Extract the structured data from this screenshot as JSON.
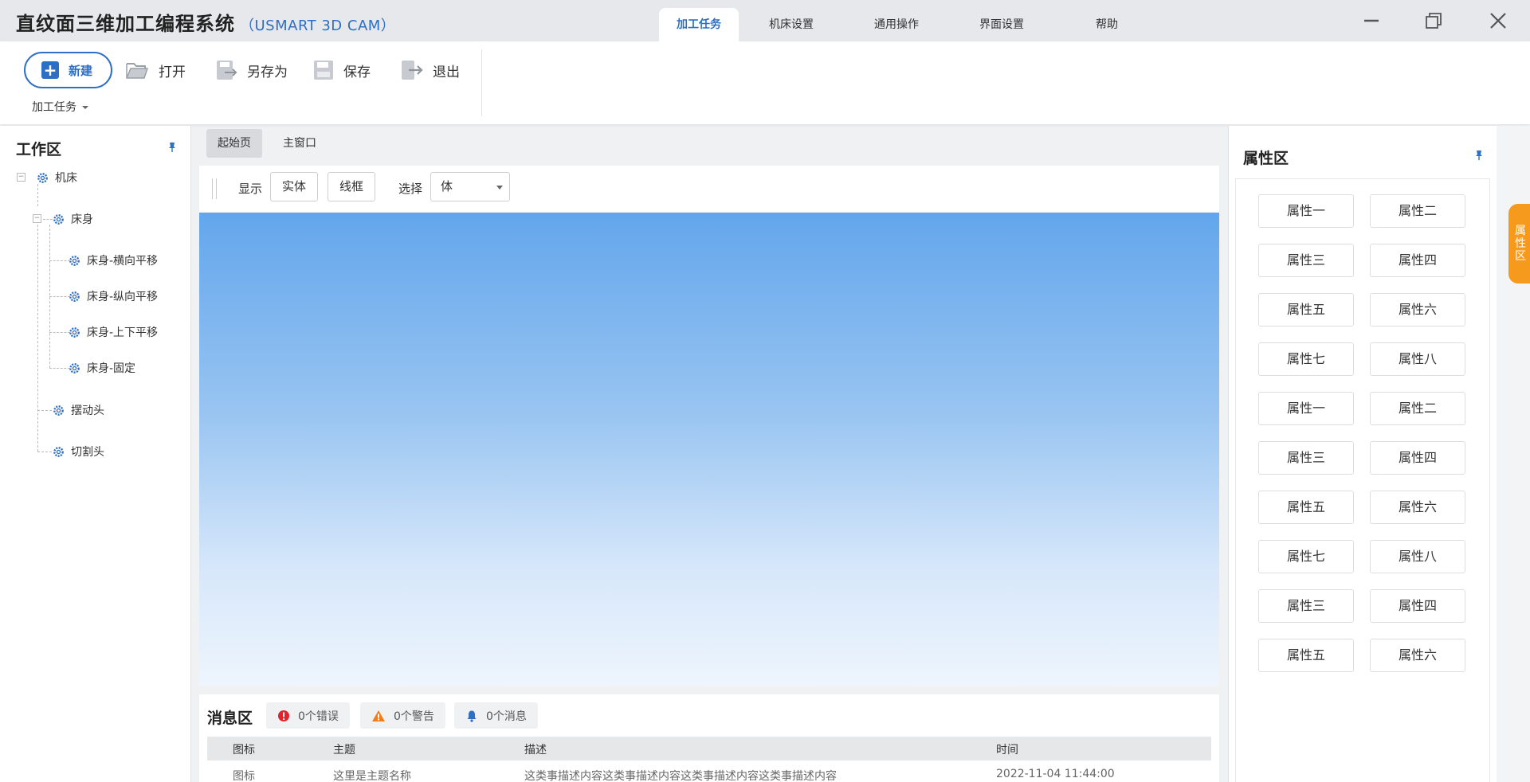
{
  "app": {
    "title": "直纹面三维加工编程系统",
    "subtitle": "（USMART 3D CAM）"
  },
  "menu_tabs": [
    {
      "label": "加工任务",
      "active": true
    },
    {
      "label": "机床设置",
      "active": false
    },
    {
      "label": "通用操作",
      "active": false
    },
    {
      "label": "界面设置",
      "active": false
    },
    {
      "label": "帮助",
      "active": false
    }
  ],
  "ribbon": {
    "new_label": "新建",
    "open_label": "打开",
    "saveas_label": "另存为",
    "save_label": "保存",
    "exit_label": "退出",
    "group_label": "加工任务"
  },
  "workspace": {
    "title": "工作区",
    "tree": {
      "root": "机床",
      "bed": "床身",
      "bed_children": [
        "床身-横向平移",
        "床身-纵向平移",
        "床身-上下平移",
        "床身-固定"
      ],
      "swing_head": "摆动头",
      "cutting_head": "切割头"
    }
  },
  "doc_tabs": [
    {
      "label": "起始页",
      "active": true
    },
    {
      "label": "主窗口",
      "active": false
    }
  ],
  "view_toolbar": {
    "display_label": "显示",
    "solid_label": "实体",
    "wireframe_label": "线框",
    "select_label": "选择",
    "select_value": "体"
  },
  "messages": {
    "title": "消息区",
    "errors": "0个错误",
    "warnings": "0个警告",
    "infos": "0个消息",
    "columns": [
      "图标",
      "主题",
      "描述",
      "时间"
    ],
    "rows": [
      {
        "icon": "图标",
        "subject": "这里是主题名称",
        "description": "这类事描述内容这类事描述内容这类事描述内容这类事描述内容",
        "time": "2022-11-04  11:44:00"
      }
    ]
  },
  "properties": {
    "title": "属性区",
    "side_tab": [
      "属",
      "性",
      "区"
    ],
    "items": [
      "属性一",
      "属性二",
      "属性三",
      "属性四",
      "属性五",
      "属性六",
      "属性七",
      "属性八",
      "属性一",
      "属性二",
      "属性三",
      "属性四",
      "属性五",
      "属性六",
      "属性七",
      "属性八",
      "属性三",
      "属性四",
      "属性五",
      "属性六"
    ]
  },
  "colors": {
    "accent": "#2d6fc4",
    "side_tab": "#f59a1d",
    "error": "#e0242e",
    "warning": "#f07d1a"
  }
}
